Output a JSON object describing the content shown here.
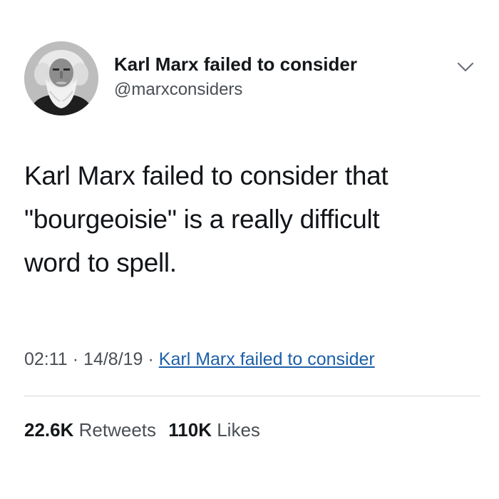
{
  "tweet": {
    "author": {
      "display_name": "Karl Marx failed to consider",
      "handle": "@marxconsiders",
      "avatar_icon": "bearded-man-portrait"
    },
    "text_lines": [
      "Karl Marx failed to consider that",
      "\"bourgeoisie\" is a really difficult",
      "word to spell."
    ],
    "time": "02:11",
    "date": "14/8/19",
    "separator": "·",
    "source": "Karl Marx failed to consider",
    "retweets": {
      "count": "22.6K",
      "label": "Retweets"
    },
    "likes": {
      "count": "110K",
      "label": "Likes"
    }
  },
  "colors": {
    "text": "#14171a",
    "secondary": "#4a4f55",
    "link": "#1c5fa8",
    "divider": "#d6d9dc"
  }
}
